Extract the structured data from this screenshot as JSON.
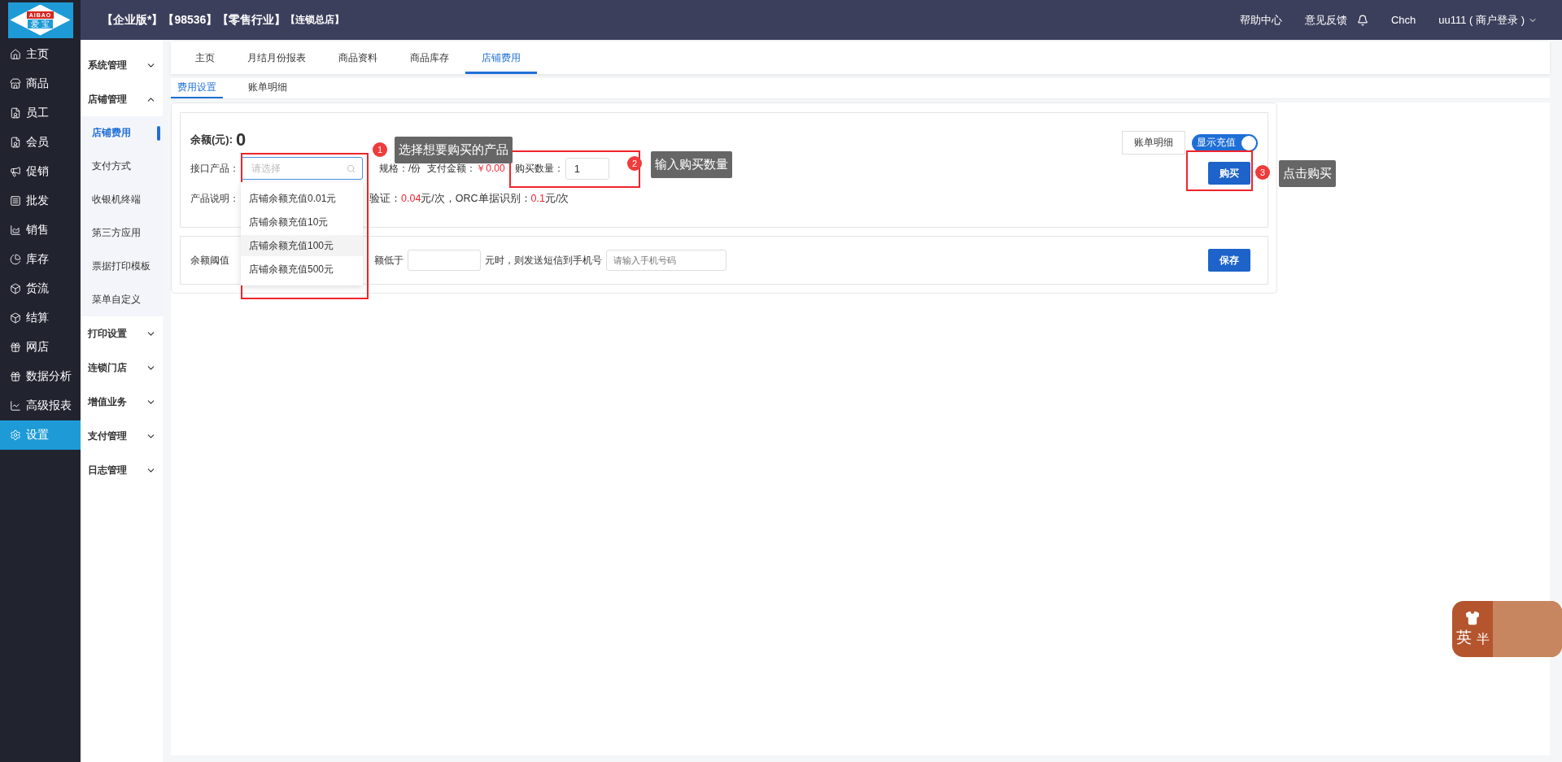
{
  "logo": {
    "top": "AIBAO",
    "bottom": "爱 宝"
  },
  "header": {
    "title_parts": [
      "【企业版*】",
      "【98536】",
      "【零售行业】",
      "【连锁总店】"
    ],
    "links": [
      "帮助中心",
      "意见反馈"
    ],
    "user_name": "Chch",
    "account": "uu111 ( 商户登录 )"
  },
  "nav": [
    {
      "label": "主页",
      "selected": false
    },
    {
      "label": "商品",
      "selected": false
    },
    {
      "label": "员工",
      "selected": false
    },
    {
      "label": "会员",
      "selected": false
    },
    {
      "label": "促销",
      "selected": false
    },
    {
      "label": "批发",
      "selected": false
    },
    {
      "label": "销售",
      "selected": false
    },
    {
      "label": "库存",
      "selected": false
    },
    {
      "label": "货流",
      "selected": false
    },
    {
      "label": "结算",
      "selected": false
    },
    {
      "label": "网店",
      "selected": false
    },
    {
      "label": "数据分析",
      "selected": false
    },
    {
      "label": "高级报表",
      "selected": false
    },
    {
      "label": "设置",
      "selected": true
    }
  ],
  "submenu": [
    {
      "label": "系统管理",
      "expanded": false
    },
    {
      "label": "店铺管理",
      "expanded": true,
      "children": [
        {
          "label": "店铺费用",
          "selected": true
        },
        {
          "label": "支付方式",
          "selected": false
        },
        {
          "label": "收银机终端",
          "selected": false
        },
        {
          "label": "第三方应用",
          "selected": false
        },
        {
          "label": "票据打印模板",
          "selected": false
        },
        {
          "label": "菜单自定义",
          "selected": false
        }
      ]
    },
    {
      "label": "打印设置",
      "expanded": false
    },
    {
      "label": "连锁门店",
      "expanded": false
    },
    {
      "label": "增值业务",
      "expanded": false
    },
    {
      "label": "支付管理",
      "expanded": false
    },
    {
      "label": "日志管理",
      "expanded": false
    }
  ],
  "tabs": [
    {
      "label": "主页",
      "selected": false
    },
    {
      "label": "月结月份报表",
      "selected": false
    },
    {
      "label": "商品资料",
      "selected": false
    },
    {
      "label": "商品库存",
      "selected": false
    },
    {
      "label": "店铺费用",
      "selected": true
    }
  ],
  "subtabs": [
    {
      "label": "费用设置",
      "selected": true
    },
    {
      "label": "账单明细",
      "selected": false
    }
  ],
  "balance": {
    "label": "余额(元):",
    "value": "0"
  },
  "bill_button": "账单明细",
  "recharge_toggle": {
    "label": "显示充值",
    "on": true
  },
  "product_select": {
    "label": "接口产品：",
    "placeholder": "请选择",
    "expanded": true,
    "options": [
      {
        "label": "店铺余额充值0.01元",
        "selected": false
      },
      {
        "label": "店铺余额充值10元",
        "selected": false
      },
      {
        "label": "店铺余额充值100元",
        "selected": true
      },
      {
        "label": "店铺余额充值500元",
        "selected": false
      }
    ]
  },
  "spec": "规格：/份",
  "pay": {
    "label": "支付金额：",
    "amount": "￥0.00"
  },
  "quantity": {
    "label": "购买数量：",
    "value": "1"
  },
  "buy_button": "购买",
  "description": {
    "label": "产品说明：",
    "segments": [
      {
        "text": "验证：",
        "highlight": false
      },
      {
        "text": "0.04",
        "highlight": true
      },
      {
        "text": "元/次，ORC单据识别：",
        "highlight": false
      },
      {
        "text": "0.1",
        "highlight": true
      },
      {
        "text": "元/次",
        "highlight": false
      }
    ]
  },
  "threshold": {
    "label": "余额阈值",
    "text_before": "额低于",
    "text_after": "元时，则发送短信到手机号",
    "phone_placeholder": "请输入手机号码",
    "save_button": "保存"
  },
  "annotations": [
    {
      "number": "1",
      "text": "选择想要购买的产品"
    },
    {
      "number": "2",
      "text": "输入购买数量"
    },
    {
      "number": "3",
      "text": "点击购买"
    }
  ],
  "ime_widget": {
    "labels": [
      "英",
      "半"
    ]
  }
}
